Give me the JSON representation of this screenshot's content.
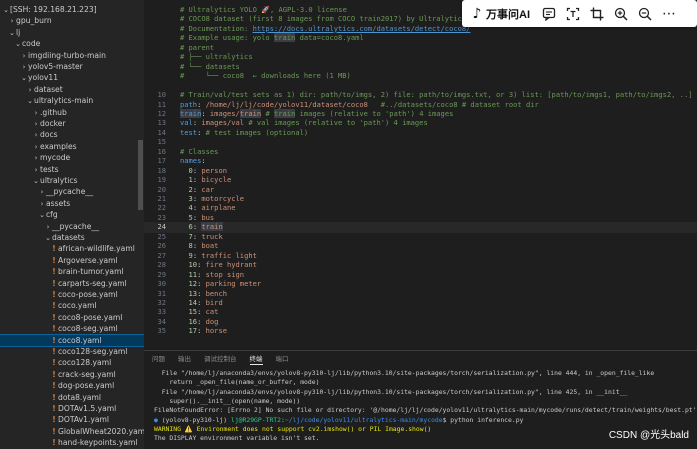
{
  "sidebar": {
    "items": [
      {
        "label": "[SSH: 192.168.21.223]",
        "chevron": "v",
        "yaml": false,
        "selected": false,
        "indent": 0
      },
      {
        "label": "gpu_burn",
        "chevron": ">",
        "yaml": false,
        "selected": false,
        "indent": 1
      },
      {
        "label": "lj",
        "chevron": "v",
        "yaml": false,
        "selected": false,
        "indent": 1
      },
      {
        "label": "code",
        "chevron": "v",
        "yaml": false,
        "selected": false,
        "indent": 2
      },
      {
        "label": "imgdiing-turbo-main",
        "chevron": ">",
        "yaml": false,
        "selected": false,
        "indent": 3
      },
      {
        "label": "yolov5-master",
        "chevron": ">",
        "yaml": false,
        "selected": false,
        "indent": 3
      },
      {
        "label": "yolov11",
        "chevron": "v",
        "yaml": false,
        "selected": false,
        "indent": 3
      },
      {
        "label": "dataset",
        "chevron": ">",
        "yaml": false,
        "selected": false,
        "indent": 4
      },
      {
        "label": "ultralytics-main",
        "chevron": "v",
        "yaml": false,
        "selected": false,
        "indent": 4
      },
      {
        "label": ".github",
        "chevron": ">",
        "yaml": false,
        "selected": false,
        "indent": 5
      },
      {
        "label": "docker",
        "chevron": ">",
        "yaml": false,
        "selected": false,
        "indent": 5
      },
      {
        "label": "docs",
        "chevron": ">",
        "yaml": false,
        "selected": false,
        "indent": 5
      },
      {
        "label": "examples",
        "chevron": ">",
        "yaml": false,
        "selected": false,
        "indent": 5
      },
      {
        "label": "mycode",
        "chevron": ">",
        "yaml": false,
        "selected": false,
        "indent": 5
      },
      {
        "label": "tests",
        "chevron": ">",
        "yaml": false,
        "selected": false,
        "indent": 5
      },
      {
        "label": "ultralytics",
        "chevron": "v",
        "yaml": false,
        "selected": false,
        "indent": 5
      },
      {
        "label": "__pycache__",
        "chevron": ">",
        "yaml": false,
        "selected": false,
        "indent": 6
      },
      {
        "label": "assets",
        "chevron": ">",
        "yaml": false,
        "selected": false,
        "indent": 6
      },
      {
        "label": "cfg",
        "chevron": "v",
        "yaml": false,
        "selected": false,
        "indent": 6
      },
      {
        "label": "__pycache__",
        "chevron": ">",
        "yaml": false,
        "selected": false,
        "indent": 7
      },
      {
        "label": "datasets",
        "chevron": "v",
        "yaml": false,
        "selected": false,
        "indent": 7
      },
      {
        "label": "african-wildlife.yaml",
        "chevron": "",
        "yaml": true,
        "selected": false,
        "indent": 8
      },
      {
        "label": "Argoverse.yaml",
        "chevron": "",
        "yaml": true,
        "selected": false,
        "indent": 8
      },
      {
        "label": "brain-tumor.yaml",
        "chevron": "",
        "yaml": true,
        "selected": false,
        "indent": 8
      },
      {
        "label": "carparts-seg.yaml",
        "chevron": "",
        "yaml": true,
        "selected": false,
        "indent": 8
      },
      {
        "label": "coco-pose.yaml",
        "chevron": "",
        "yaml": true,
        "selected": false,
        "indent": 8
      },
      {
        "label": "coco.yaml",
        "chevron": "",
        "yaml": true,
        "selected": false,
        "indent": 8
      },
      {
        "label": "coco8-pose.yaml",
        "chevron": "",
        "yaml": true,
        "selected": false,
        "indent": 8
      },
      {
        "label": "coco8-seg.yaml",
        "chevron": "",
        "yaml": true,
        "selected": false,
        "indent": 8
      },
      {
        "label": "coco8.yaml",
        "chevron": "",
        "yaml": true,
        "selected": true,
        "indent": 8
      },
      {
        "label": "coco128-seg.yaml",
        "chevron": "",
        "yaml": true,
        "selected": false,
        "indent": 8
      },
      {
        "label": "coco128.yaml",
        "chevron": "",
        "yaml": true,
        "selected": false,
        "indent": 8
      },
      {
        "label": "crack-seg.yaml",
        "chevron": "",
        "yaml": true,
        "selected": false,
        "indent": 8
      },
      {
        "label": "dog-pose.yaml",
        "chevron": "",
        "yaml": true,
        "selected": false,
        "indent": 8
      },
      {
        "label": "dota8.yaml",
        "chevron": "",
        "yaml": true,
        "selected": false,
        "indent": 8
      },
      {
        "label": "DOTAv1.5.yaml",
        "chevron": "",
        "yaml": true,
        "selected": false,
        "indent": 8
      },
      {
        "label": "DOTAv1.yaml",
        "chevron": "",
        "yaml": true,
        "selected": false,
        "indent": 8
      },
      {
        "label": "GlobalWheat2020.yaml",
        "chevron": "",
        "yaml": true,
        "selected": false,
        "indent": 8
      },
      {
        "label": "hand-keypoints.yaml",
        "chevron": "",
        "yaml": true,
        "selected": false,
        "indent": 8
      }
    ]
  },
  "editor": {
    "lines": [
      {
        "n": "",
        "current": false,
        "parts": [
          {
            "c": "c-com",
            "t": "# Ultralytics YOLO 🚀, AGPL-3.0 license"
          }
        ]
      },
      {
        "n": "",
        "current": false,
        "parts": [
          {
            "c": "c-com",
            "t": "# COCO8 dataset (first 8 images from COCO train2017) by Ultralytics"
          }
        ]
      },
      {
        "n": "",
        "current": false,
        "parts": [
          {
            "c": "c-com",
            "t": "# Documentation: "
          },
          {
            "c": "c-link",
            "t": "https://docs.ultralytics.com/datasets/detect/coco8/"
          }
        ]
      },
      {
        "n": "",
        "current": false,
        "parts": [
          {
            "c": "c-com",
            "t": "# Example usage: yolo "
          },
          {
            "c": "c-com hl",
            "t": "train"
          },
          {
            "c": "c-com",
            "t": " data=coco8.yaml"
          }
        ]
      },
      {
        "n": "",
        "current": false,
        "parts": [
          {
            "c": "c-com",
            "t": "# parent"
          }
        ]
      },
      {
        "n": "",
        "current": false,
        "parts": [
          {
            "c": "c-com",
            "t": "# ├── ultralytics"
          }
        ]
      },
      {
        "n": "",
        "current": false,
        "parts": [
          {
            "c": "c-com",
            "t": "# └── datasets"
          }
        ]
      },
      {
        "n": "",
        "current": false,
        "parts": [
          {
            "c": "c-com",
            "t": "#     └── coco8  ← downloads here (1 MB)"
          }
        ]
      },
      {
        "n": "",
        "current": false,
        "parts": []
      },
      {
        "n": "10",
        "current": false,
        "parts": [
          {
            "c": "c-com",
            "t": "# Train/val/test sets as 1) dir: path/to/imgs, 2) file: path/to/imgs.txt, or 3) list: [path/to/imgs1, path/to/imgs2, ..]"
          }
        ]
      },
      {
        "n": "11",
        "current": false,
        "parts": [
          {
            "c": "c-key",
            "t": "path"
          },
          {
            "c": "c-txt",
            "t": ": "
          },
          {
            "c": "c-val",
            "t": "/home/lj/lj/code/yolov11/dataset/coco8"
          },
          {
            "c": "c-com",
            "t": "   #../datasets/coco8 # dataset root dir"
          }
        ]
      },
      {
        "n": "12",
        "current": false,
        "parts": [
          {
            "c": "c-key hl",
            "t": "train"
          },
          {
            "c": "c-txt",
            "t": ": "
          },
          {
            "c": "c-val",
            "t": "images/"
          },
          {
            "c": "c-val hl",
            "t": "train"
          },
          {
            "c": "c-com",
            "t": " # "
          },
          {
            "c": "c-com hl",
            "t": "train"
          },
          {
            "c": "c-com",
            "t": " images (relative to 'path') 4 images"
          }
        ]
      },
      {
        "n": "13",
        "current": false,
        "parts": [
          {
            "c": "c-key",
            "t": "val"
          },
          {
            "c": "c-txt",
            "t": ": "
          },
          {
            "c": "c-val",
            "t": "images/val"
          },
          {
            "c": "c-com",
            "t": " # val images (relative to 'path') 4 images"
          }
        ]
      },
      {
        "n": "14",
        "current": false,
        "parts": [
          {
            "c": "c-key",
            "t": "test"
          },
          {
            "c": "c-txt",
            "t": ": "
          },
          {
            "c": "c-com",
            "t": "# test images (optional)"
          }
        ]
      },
      {
        "n": "15",
        "current": false,
        "parts": []
      },
      {
        "n": "16",
        "current": false,
        "parts": [
          {
            "c": "c-com",
            "t": "# Classes"
          }
        ]
      },
      {
        "n": "17",
        "current": false,
        "parts": [
          {
            "c": "c-key",
            "t": "names"
          },
          {
            "c": "c-txt",
            "t": ":"
          }
        ]
      },
      {
        "n": "18",
        "current": false,
        "parts": [
          {
            "c": "c-num",
            "t": "  0"
          },
          {
            "c": "c-txt",
            "t": ": "
          },
          {
            "c": "c-val",
            "t": "person"
          }
        ]
      },
      {
        "n": "19",
        "current": false,
        "parts": [
          {
            "c": "c-num",
            "t": "  1"
          },
          {
            "c": "c-txt",
            "t": ": "
          },
          {
            "c": "c-val",
            "t": "bicycle"
          }
        ]
      },
      {
        "n": "20",
        "current": false,
        "parts": [
          {
            "c": "c-num",
            "t": "  2"
          },
          {
            "c": "c-txt",
            "t": ": "
          },
          {
            "c": "c-val",
            "t": "car"
          }
        ]
      },
      {
        "n": "21",
        "current": false,
        "parts": [
          {
            "c": "c-num",
            "t": "  3"
          },
          {
            "c": "c-txt",
            "t": ": "
          },
          {
            "c": "c-val",
            "t": "motorcycle"
          }
        ]
      },
      {
        "n": "22",
        "current": false,
        "parts": [
          {
            "c": "c-num",
            "t": "  4"
          },
          {
            "c": "c-txt",
            "t": ": "
          },
          {
            "c": "c-val",
            "t": "airplane"
          }
        ]
      },
      {
        "n": "23",
        "current": false,
        "parts": [
          {
            "c": "c-num",
            "t": "  5"
          },
          {
            "c": "c-txt",
            "t": ": "
          },
          {
            "c": "c-val",
            "t": "bus"
          }
        ]
      },
      {
        "n": "24",
        "current": true,
        "parts": [
          {
            "c": "c-num",
            "t": "  6"
          },
          {
            "c": "c-txt",
            "t": ": "
          },
          {
            "c": "c-val hl",
            "t": "train"
          }
        ]
      },
      {
        "n": "25",
        "current": false,
        "parts": [
          {
            "c": "c-num",
            "t": "  7"
          },
          {
            "c": "c-txt",
            "t": ": "
          },
          {
            "c": "c-val",
            "t": "truck"
          }
        ]
      },
      {
        "n": "26",
        "current": false,
        "parts": [
          {
            "c": "c-num",
            "t": "  8"
          },
          {
            "c": "c-txt",
            "t": ": "
          },
          {
            "c": "c-val",
            "t": "boat"
          }
        ]
      },
      {
        "n": "27",
        "current": false,
        "parts": [
          {
            "c": "c-num",
            "t": "  9"
          },
          {
            "c": "c-txt",
            "t": ": "
          },
          {
            "c": "c-val",
            "t": "traffic light"
          }
        ]
      },
      {
        "n": "28",
        "current": false,
        "parts": [
          {
            "c": "c-num",
            "t": "  10"
          },
          {
            "c": "c-txt",
            "t": ": "
          },
          {
            "c": "c-val",
            "t": "fire hydrant"
          }
        ]
      },
      {
        "n": "29",
        "current": false,
        "parts": [
          {
            "c": "c-num",
            "t": "  11"
          },
          {
            "c": "c-txt",
            "t": ": "
          },
          {
            "c": "c-val",
            "t": "stop sign"
          }
        ]
      },
      {
        "n": "30",
        "current": false,
        "parts": [
          {
            "c": "c-num",
            "t": "  12"
          },
          {
            "c": "c-txt",
            "t": ": "
          },
          {
            "c": "c-val",
            "t": "parking meter"
          }
        ]
      },
      {
        "n": "31",
        "current": false,
        "parts": [
          {
            "c": "c-num",
            "t": "  13"
          },
          {
            "c": "c-txt",
            "t": ": "
          },
          {
            "c": "c-val",
            "t": "bench"
          }
        ]
      },
      {
        "n": "32",
        "current": false,
        "parts": [
          {
            "c": "c-num",
            "t": "  14"
          },
          {
            "c": "c-txt",
            "t": ": "
          },
          {
            "c": "c-val",
            "t": "bird"
          }
        ]
      },
      {
        "n": "33",
        "current": false,
        "parts": [
          {
            "c": "c-num",
            "t": "  15"
          },
          {
            "c": "c-txt",
            "t": ": "
          },
          {
            "c": "c-val",
            "t": "cat"
          }
        ]
      },
      {
        "n": "34",
        "current": false,
        "parts": [
          {
            "c": "c-num",
            "t": "  16"
          },
          {
            "c": "c-txt",
            "t": ": "
          },
          {
            "c": "c-val",
            "t": "dog"
          }
        ]
      },
      {
        "n": "35",
        "current": false,
        "parts": [
          {
            "c": "c-num",
            "t": "  17"
          },
          {
            "c": "c-txt",
            "t": ": "
          },
          {
            "c": "c-val",
            "t": "horse"
          }
        ]
      }
    ]
  },
  "toolbar": {
    "ai_label": "万事问AI",
    "icons": [
      "message-icon",
      "text-extract-icon",
      "crop-icon",
      "zoom-in-icon",
      "zoom-out-icon",
      "more-icon"
    ]
  },
  "panel": {
    "tabs": [
      "问题",
      "输出",
      "调试控制台",
      "终端",
      "端口"
    ],
    "active_tab": 3,
    "terminal": [
      {
        "parts": [
          {
            "c": "",
            "t": "  File \"/home/lj/anaconda3/envs/yolov8-py310-lj/lib/python3.10/site-packages/torch/serialization.py\", line 444, in _open_file_like"
          }
        ]
      },
      {
        "parts": [
          {
            "c": "",
            "t": "    return _open_file(name_or_buffer, mode)"
          }
        ]
      },
      {
        "parts": [
          {
            "c": "",
            "t": "  File \"/home/lj/anaconda3/envs/yolov8-py310-lj/lib/python3.10/site-packages/torch/serialization.py\", line 425, in __init__"
          }
        ]
      },
      {
        "parts": [
          {
            "c": "",
            "t": "    super().__init__(open(name, mode))"
          }
        ]
      },
      {
        "parts": [
          {
            "c": "",
            "t": "FileNotFoundError: [Errno 2] No such file or directory: '@/home/lj/lj/code/yolov11/ultralytics-main/mycode/runs/detect/train/weights/best.pt'"
          }
        ]
      },
      {
        "parts": [
          {
            "c": "t-dot",
            "t": "● "
          },
          {
            "c": "",
            "t": "(yolov8-py310-lj) "
          },
          {
            "c": "t-green",
            "t": "lj@R29GP-TRT2"
          },
          {
            "c": "",
            "t": ":"
          },
          {
            "c": "t-blue",
            "t": "~/lj/code/yolov11/ultralytics-main/mycode"
          },
          {
            "c": "",
            "t": "$ python inference.py"
          }
        ]
      },
      {
        "parts": [
          {
            "c": "t-yellow",
            "t": "WARNING ⚠️ Environment does not support cv2.imshow() or PIL Image.show()"
          }
        ]
      },
      {
        "parts": [
          {
            "c": "",
            "t": "The DISPLAY environment variable isn't set."
          }
        ]
      }
    ]
  },
  "watermark": "CSDN @光头bald"
}
